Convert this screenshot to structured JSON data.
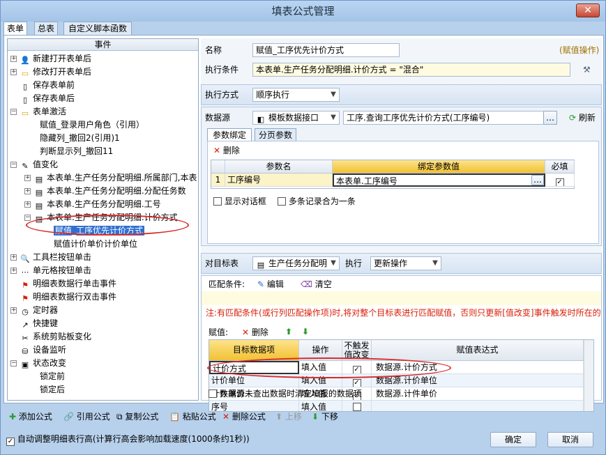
{
  "window": {
    "title": "填表公式管理",
    "close": "✕"
  },
  "tabs": [
    "表单",
    "总表",
    "自定义脚本函数"
  ],
  "left": {
    "header": "事件",
    "tree": [
      {
        "label": "新建打开表单后"
      },
      {
        "label": "修改打开表单后"
      },
      {
        "label": "保存表单前"
      },
      {
        "label": "保存表单后"
      },
      {
        "label": "表单激活"
      },
      {
        "label": "赋值_登录用户角色（引用）"
      },
      {
        "label": "隐藏列_撤回2(引用)1"
      },
      {
        "label": "判断显示列_撤回11"
      },
      {
        "label": "值变化"
      },
      {
        "label": "本表单.生产任务分配明细.所属部门,本表"
      },
      {
        "label": "本表单.生产任务分配明细.分配任务数"
      },
      {
        "label": "本表单.生产任务分配明细.工号"
      },
      {
        "label": "本表单.生产任务分配明细.计价方式"
      },
      {
        "label": "赋值_工序优先计价方式"
      },
      {
        "label": "赋值计价单价计价单位"
      },
      {
        "label": "工具栏按钮单击"
      },
      {
        "label": "单元格按钮单击"
      },
      {
        "label": "明细表数据行单击事件"
      },
      {
        "label": "明细表数据行双击事件"
      },
      {
        "label": "定时器"
      },
      {
        "label": "快捷键"
      },
      {
        "label": "系统剪贴板变化"
      },
      {
        "label": "设备监听"
      },
      {
        "label": "状态改变"
      },
      {
        "label": "锁定前"
      },
      {
        "label": "锁定后"
      }
    ]
  },
  "form": {
    "name_label": "名称",
    "name_value": "赋值_工序优先计价方式",
    "op_type": "(赋值操作)",
    "cond_label": "执行条件",
    "cond_value": "本表单.生产任务分配明细.计价方式  = \"混合\"",
    "exec_label": "执行方式",
    "exec_value": "顺序执行",
    "source_label": "数据源",
    "source_type": "模板数据接口",
    "source_value": "工序.查询工序优先计价方式(工序编号)",
    "refresh": "刷新",
    "param_tabs": [
      "参数绑定",
      "分页参数"
    ],
    "delete": "删除",
    "param_headers": [
      "参数名",
      "绑定参数值",
      "必填"
    ],
    "param_rows": [
      {
        "no": "1",
        "name": "工序编号",
        "value": "本表单.工序编号"
      }
    ],
    "show_dialog": "显示对话框",
    "merge_rows": "多条记录合为一条",
    "target_label": "对目标表",
    "target_value": "生产任务分配明",
    "exec2_label": "执行",
    "exec2_value": "更新操作",
    "match_label": "匹配条件:",
    "edit": "编辑",
    "clear": "清空",
    "note": "注:有匹配条件(或行列匹配操作项)时,将对整个目标表进行匹配赋值，否则只更新[值改变]事件触发时所在的",
    "assign_label": "赋值:",
    "assign_headers": [
      "目标数据项",
      "操作",
      "不触发值改变",
      "赋值表达式"
    ],
    "assign_rows": [
      {
        "target": "计价方式",
        "op": "填入值",
        "expr": "数据源.计价方式"
      },
      {
        "target": "计价单位",
        "op": "填入值",
        "expr": "数据源.计价单位"
      },
      {
        "target": "计件单价",
        "op": "填入值",
        "expr": "数据源.计件单价"
      },
      {
        "target": "序号",
        "op": "填入值",
        "expr": ""
      }
    ],
    "clear_empty": "数据源未查出数据时清空填报的数据项"
  },
  "toolbar": {
    "add": "添加公式",
    "ref": "引用公式",
    "copy": "复制公式",
    "paste": "粘贴公式",
    "del": "删除公式",
    "up": "上移",
    "down": "下移"
  },
  "footer": {
    "auto": "自动调整明细表行高(计算行高会影响加载速度(1000条约1秒))",
    "ok": "确定",
    "cancel": "取消"
  }
}
